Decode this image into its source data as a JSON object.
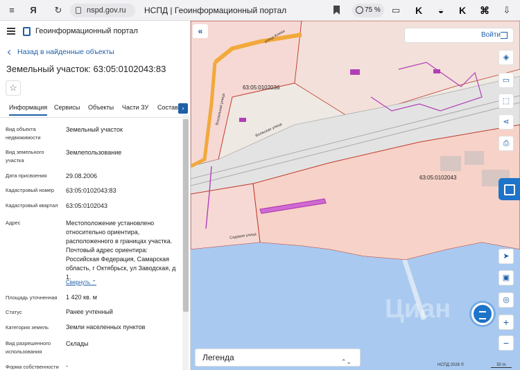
{
  "browser": {
    "url": "nspd.gov.ru",
    "tab_title": "НСПД | Геоинформационный портал",
    "zoom": "75 %",
    "nav_icons": [
      "menu-icon",
      "yandex-icon",
      "back-icon",
      "reload-icon",
      "lock-icon",
      "bookmark-icon",
      "chat-icon"
    ]
  },
  "panel": {
    "portal_name": "Геоинформационный портал",
    "back_label": "Назад в найденные объекты",
    "object_title": "Земельный участок: 63:05:0102043:83",
    "star": "☆",
    "tabs": [
      "Информация",
      "Сервисы",
      "Объекты",
      "Части ЗУ",
      "Состав"
    ],
    "tab_arrow": "›",
    "attributes": [
      {
        "label": "Вид объекта недвижимости",
        "value": "Земельный участок"
      },
      {
        "label": "Вид земельного участка",
        "value": "Землепользование"
      },
      {
        "label": "Дата присвоения",
        "value": "29.08.2006"
      },
      {
        "label": "Кадастровый номер",
        "value": "63:05:0102043:83"
      },
      {
        "label": "Кадастровый квартал",
        "value": "63:05:0102043"
      },
      {
        "label": "Адрес",
        "value": "Местоположение установлено относительно ориентира, расположенного в границах участка. Почтовый адрес ориентира: Российская Федерация, Самарская область, г Октябрьск, ул Заводская, д 1."
      },
      {
        "label": "Площадь уточненная",
        "value": "1 420 кв. м"
      },
      {
        "label": "Статус",
        "value": "Ранее учтенный"
      },
      {
        "label": "Категория земель",
        "value": "Земли населенных пунктов"
      },
      {
        "label": "Вид разрешенного использования",
        "value": "Склады"
      },
      {
        "label": "Форма собственности",
        "value": "-"
      }
    ],
    "collapse_label": "Свернуть ⌃"
  },
  "map": {
    "login_label": "Войти",
    "collapse_symbol": "«",
    "legend_label": "Легенда",
    "legend_chevron": "⌃⌄",
    "parcel_labels": [
      "63:05:0102036",
      "63:05:0102043"
    ],
    "street_labels": [
      "улица Клюка",
      "Вокзальная улица",
      "Волжская улица",
      "Садовая улица"
    ],
    "copyright": "НСПД 2026 ©",
    "scale": "50 m",
    "watermark": "Циан",
    "tools": [
      "layers-icon",
      "ruler-icon",
      "select-area-icon",
      "share-icon",
      "print-icon"
    ],
    "bottom_tools": [
      "locate-icon",
      "layer-switch-icon",
      "compass-icon"
    ],
    "zoom_in": "+",
    "zoom_out": "−",
    "colors": {
      "water": "#a9c9f0",
      "parcel": "#f6d9d4",
      "boundary": "#c0392b",
      "highlight": "#b13fb5",
      "road": "#f2a93b"
    }
  }
}
